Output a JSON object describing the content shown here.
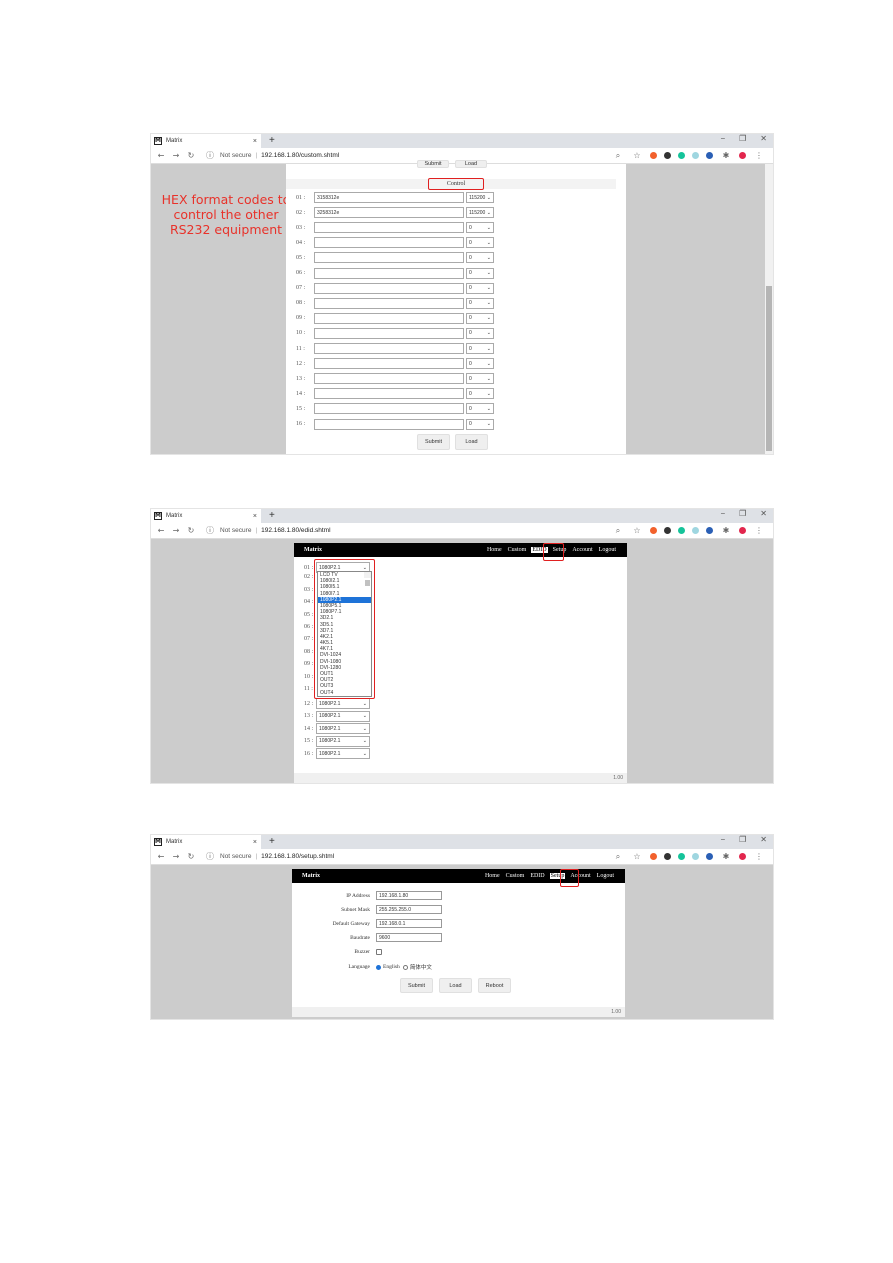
{
  "browser": {
    "tab_title": "Matrix",
    "favicon_letter": "M",
    "new_tab": "+",
    "tab_close": "×",
    "security": "Not secure",
    "separator": "|",
    "window_controls": [
      "−",
      "❐",
      "✕"
    ]
  },
  "screenshots": [
    {
      "url": "192.168.1.80/custom.shtml",
      "top_buttons": [
        "Submit",
        "Load"
      ],
      "section_title": "Control",
      "annotation": [
        "HEX format codes to",
        "control the other",
        "RS232 equipment"
      ],
      "rows": [
        {
          "num": "01 :",
          "code": "3158312e",
          "baud": "115200"
        },
        {
          "num": "02 :",
          "code": "3258312e",
          "baud": "115200"
        },
        {
          "num": "03 :",
          "code": "",
          "baud": "0"
        },
        {
          "num": "04 :",
          "code": "",
          "baud": "0"
        },
        {
          "num": "05 :",
          "code": "",
          "baud": "0"
        },
        {
          "num": "06 :",
          "code": "",
          "baud": "0"
        },
        {
          "num": "07 :",
          "code": "",
          "baud": "0"
        },
        {
          "num": "08 :",
          "code": "",
          "baud": "0"
        },
        {
          "num": "09 :",
          "code": "",
          "baud": "0"
        },
        {
          "num": "10 :",
          "code": "",
          "baud": "0"
        },
        {
          "num": "11 :",
          "code": "",
          "baud": "0"
        },
        {
          "num": "12 :",
          "code": "",
          "baud": "0"
        },
        {
          "num": "13 :",
          "code": "",
          "baud": "0"
        },
        {
          "num": "14 :",
          "code": "",
          "baud": "0"
        },
        {
          "num": "15 :",
          "code": "",
          "baud": "0"
        },
        {
          "num": "16 :",
          "code": "",
          "baud": "0"
        }
      ],
      "buttons": [
        "Submit",
        "Load"
      ]
    },
    {
      "url": "192.168.1.80/edid.shtml",
      "brand": "Matrix",
      "nav": [
        "Home",
        "Custom",
        "EDID",
        "Setup",
        "Account",
        "Logout"
      ],
      "active_nav": "EDID",
      "row_labels": [
        "01 :",
        "02 :",
        "03 :",
        "04 :",
        "05 :",
        "06 :",
        "07 :",
        "08 :",
        "09 :",
        "10 :",
        "11 :",
        "12 :",
        "13 :",
        "14 :",
        "15 :",
        "16 :"
      ],
      "selected_value": "1080P2.1",
      "dropdown_options": [
        "LCD TV",
        "1080I2.1",
        "1080I5.1",
        "1080I7.1",
        "1080P2.1",
        "1080P5.1",
        "1080P7.1",
        "3D2.1",
        "3D5.1",
        "3D7.1",
        "4K2.1",
        "4K5.1",
        "4K7.1",
        "DVI-1024",
        "DVI-1080",
        "DVI-1280",
        "OUT1",
        "OUT2",
        "OUT3",
        "OUT4"
      ],
      "highlighted_option": "1080P2.1",
      "footer_version": "1.00"
    },
    {
      "url": "192.168.1.80/setup.shtml",
      "brand": "Matrix",
      "nav": [
        "Home",
        "Custom",
        "EDID",
        "Setup",
        "Account",
        "Logout"
      ],
      "active_nav": "Setup",
      "fields": [
        {
          "label": "IP Address",
          "value": "192.168.1.80"
        },
        {
          "label": "Subnet Mask",
          "value": "255.255.255.0"
        },
        {
          "label": "Default Gateway",
          "value": "192.168.0.1"
        },
        {
          "label": "Baudrate",
          "value": "9600"
        }
      ],
      "buzzer_label": "Buzzer",
      "buzzer_checked": false,
      "language_label": "Language",
      "language_options": [
        "English",
        "简体中文"
      ],
      "language_selected": "English",
      "buttons": [
        "Submit",
        "Load",
        "Reboot"
      ],
      "footer_version": "1.00"
    }
  ],
  "colors": {
    "annotation_red": "#e8322a",
    "highlight_blue": "#1e73d8",
    "header_black": "#000000"
  }
}
